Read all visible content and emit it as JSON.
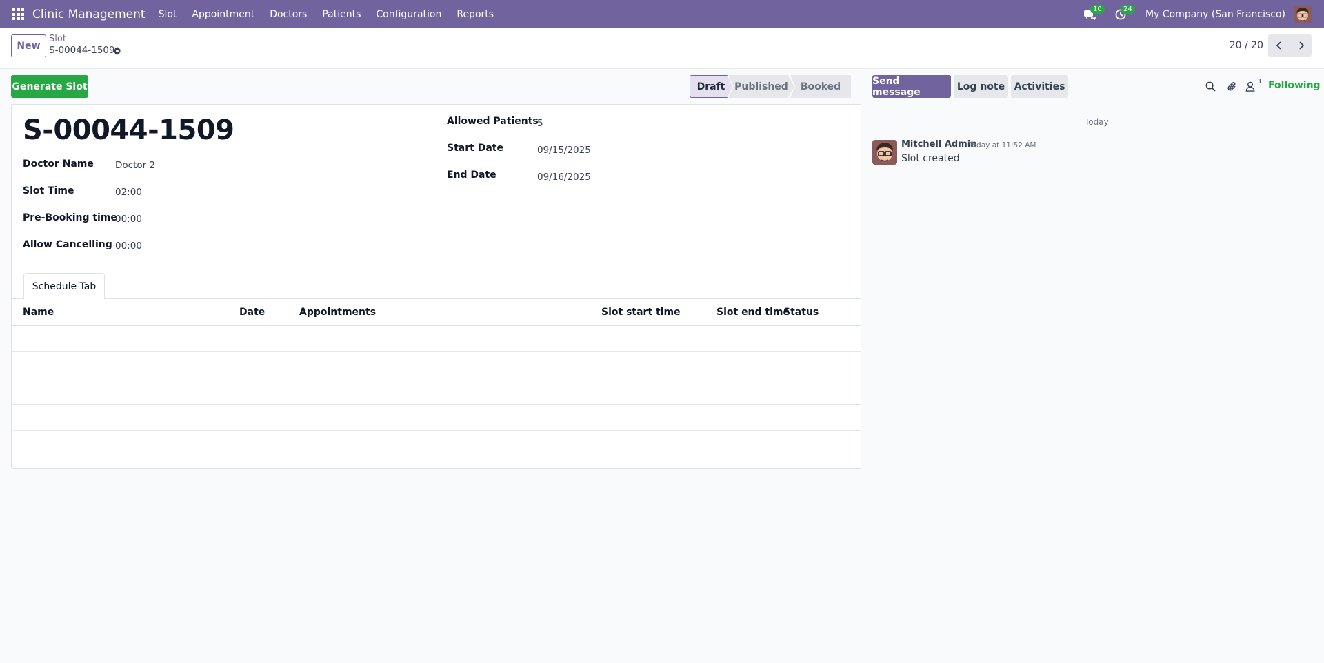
{
  "navbar": {
    "brand": "Clinic Management",
    "menu": [
      "Slot",
      "Appointment",
      "Doctors",
      "Patients",
      "Configuration",
      "Reports"
    ],
    "messages_badge": "10",
    "activities_badge": "24",
    "company": "My Company (San Francisco)"
  },
  "control": {
    "new_label": "New",
    "breadcrumb_parent": "Slot",
    "breadcrumb_current": "S-00044-1509",
    "pager": "20 / 20"
  },
  "header": {
    "generate_label": "Generate Slot",
    "status": [
      "Draft",
      "Published",
      "Booked"
    ],
    "active_status": "Draft"
  },
  "form": {
    "title": "S-00044-1509",
    "left_fields": [
      {
        "label": "Doctor Name",
        "value": "Doctor 2"
      },
      {
        "label": "Slot Time",
        "value": "02:00"
      },
      {
        "label": "Pre-Booking time",
        "value": "00:00"
      },
      {
        "label": "Allow Cancelling",
        "value": "00:00"
      }
    ],
    "right_fields": [
      {
        "label": "Allowed Patients",
        "value": "5"
      },
      {
        "label": "Start Date",
        "value": "09/15/2025"
      },
      {
        "label": "End Date",
        "value": "09/16/2025"
      }
    ],
    "tab_label": "Schedule Tab",
    "columns": [
      "Name",
      "Date",
      "Appointments",
      "Slot start time",
      "Slot end time",
      "Status"
    ]
  },
  "chatter": {
    "send_label": "Send message",
    "log_label": "Log note",
    "activities_label": "Activities",
    "follower_count": "1",
    "following_label": "Following",
    "day_label": "Today",
    "author": "Mitchell Admin",
    "date": "Today at 11:52 AM",
    "body": "Slot created"
  },
  "colors": {
    "brand": "#71639e",
    "success": "#28a745"
  }
}
